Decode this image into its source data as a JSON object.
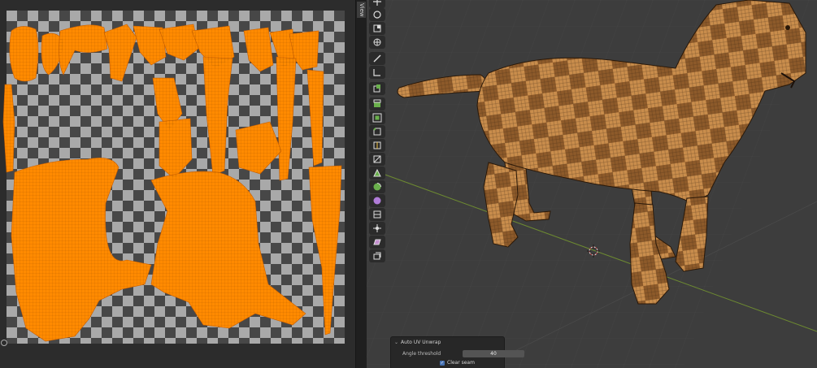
{
  "uv_editor": {
    "sidebar_tab": "View"
  },
  "redo_panel": {
    "title": "Auto UV Unwrap",
    "angle_threshold_label": "Angle threshold",
    "angle_threshold_value": "40",
    "clear_seam_label": "Clear seam",
    "clear_seam_checked": true
  },
  "toolbar": {
    "tools": [
      {
        "name": "move",
        "icon": "move-icon"
      },
      {
        "name": "rotate",
        "icon": "rotate-icon"
      },
      {
        "name": "scale",
        "icon": "scale-icon"
      },
      {
        "name": "transform",
        "icon": "transform-icon"
      },
      {
        "name": "annotate",
        "icon": "annotate-icon"
      },
      {
        "name": "measure",
        "icon": "measure-icon"
      },
      {
        "name": "add-cube",
        "icon": "add-cube-icon"
      },
      {
        "name": "extrude",
        "icon": "extrude-icon"
      },
      {
        "name": "inset",
        "icon": "inset-icon"
      },
      {
        "name": "bevel",
        "icon": "bevel-icon"
      },
      {
        "name": "loop-cut",
        "icon": "loop-cut-icon"
      },
      {
        "name": "knife",
        "icon": "knife-icon"
      },
      {
        "name": "poly-build",
        "icon": "poly-build-icon"
      },
      {
        "name": "spin",
        "icon": "spin-icon"
      },
      {
        "name": "smooth",
        "icon": "smooth-icon"
      },
      {
        "name": "edge-slide",
        "icon": "edge-slide-icon"
      },
      {
        "name": "shrink-fatten",
        "icon": "shrink-fatten-icon"
      },
      {
        "name": "shear",
        "icon": "shear-icon"
      },
      {
        "name": "rip-region",
        "icon": "rip-region-icon"
      }
    ]
  },
  "colors": {
    "uv_island": "#ff8a00",
    "model_tint": "#b77a3a",
    "accent_blue": "#4772b3"
  }
}
